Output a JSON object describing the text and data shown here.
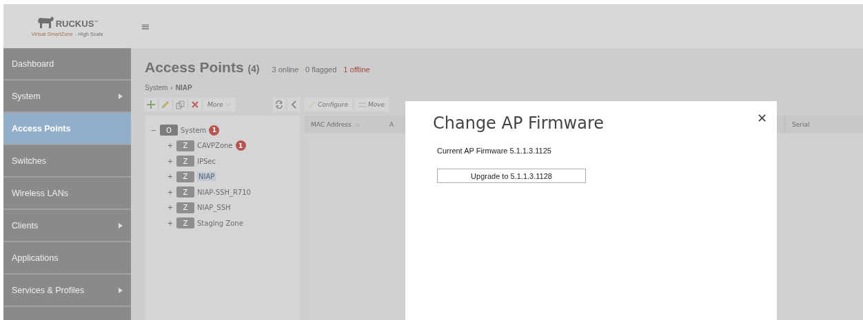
{
  "header": {
    "brand": "RUCKUS",
    "brand_tm": "™",
    "product": "Virtual SmartZone",
    "edition": "- High Scale",
    "menu_icon": "≡"
  },
  "sidebar": {
    "items": [
      {
        "label": "Dashboard",
        "selected": false,
        "has_submenu": false
      },
      {
        "label": "System",
        "selected": false,
        "has_submenu": true
      },
      {
        "label": "Access Points",
        "selected": true,
        "has_submenu": false
      },
      {
        "label": "Switches",
        "selected": false,
        "has_submenu": false
      },
      {
        "label": "Wireless LANs",
        "selected": false,
        "has_submenu": false
      },
      {
        "label": "Clients",
        "selected": false,
        "has_submenu": true
      },
      {
        "label": "Applications",
        "selected": false,
        "has_submenu": false
      },
      {
        "label": "Services & Profiles",
        "selected": false,
        "has_submenu": true
      }
    ]
  },
  "page": {
    "title": "Access Points",
    "count": "(4)",
    "stats": [
      {
        "text": "3 online",
        "kind": "normal"
      },
      {
        "text": "0 flagged",
        "kind": "normal"
      },
      {
        "text": "1 offline",
        "kind": "alert"
      }
    ],
    "breadcrumb": [
      "System",
      "NIAP"
    ],
    "breadcrumb_separator": "›",
    "toolbar": {
      "more": "More",
      "actions": [
        "Configure",
        "Move"
      ]
    }
  },
  "tree": {
    "nodes": [
      {
        "toggle": "−",
        "badge": "O",
        "label": "System",
        "alerts": "1",
        "selected": false,
        "children": [
          {
            "toggle": "+",
            "badge": "Z",
            "label": "CAVPZone",
            "alerts": "1",
            "selected": false
          },
          {
            "toggle": "+",
            "badge": "Z",
            "label": "IPSec",
            "selected": false
          },
          {
            "toggle": "+",
            "badge": "Z",
            "label": "NIAP",
            "selected": true
          },
          {
            "toggle": "+",
            "badge": "Z",
            "label": "NIAP-SSH_R710",
            "selected": false
          },
          {
            "toggle": "+",
            "badge": "Z",
            "label": "NIAP_SSH",
            "selected": false
          },
          {
            "toggle": "+",
            "badge": "Z",
            "label": "Staging Zone",
            "selected": false
          }
        ]
      }
    ]
  },
  "table": {
    "columns": [
      {
        "label": "MAC Address",
        "sorted": true
      },
      {
        "label": "A"
      },
      {
        "label": "Serial"
      }
    ]
  },
  "dialog": {
    "title": "Change AP Firmware",
    "close": "✕",
    "current": "Current AP Firmware 5.1.1.3.1125",
    "upgrade_button": "Upgrade to 5.1.1.3.1128"
  }
}
